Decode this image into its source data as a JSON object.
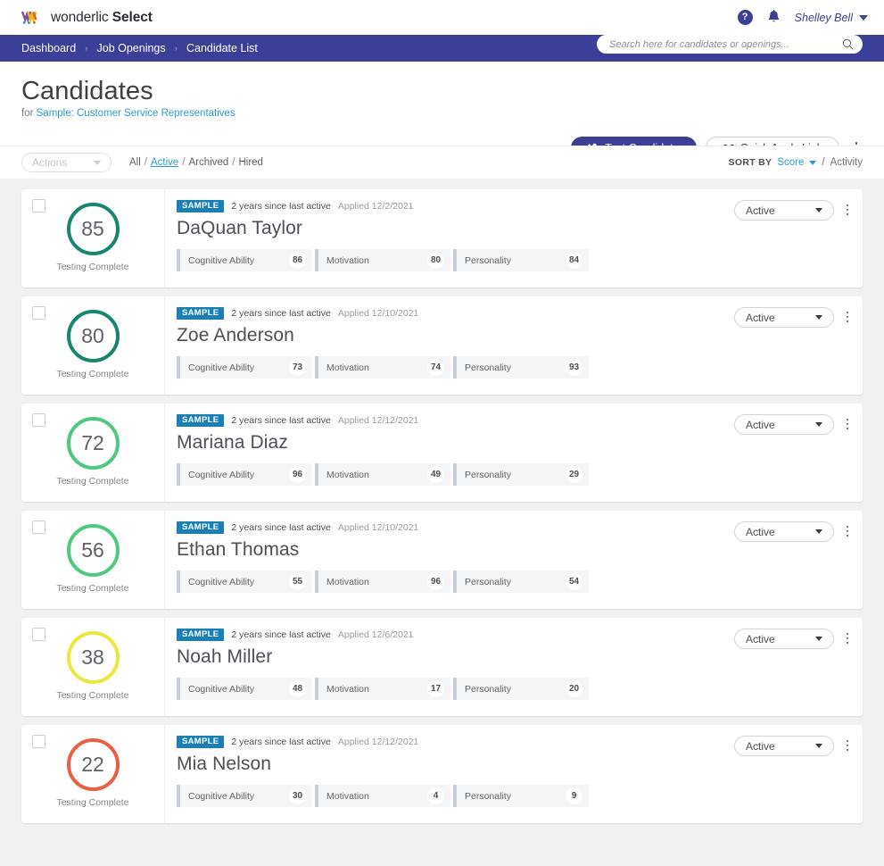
{
  "brand": {
    "name_light": "wonderlic",
    "name_bold": "Select",
    "primary_color": "#3b3f98",
    "link_color": "#2d9cd6"
  },
  "topbar": {
    "help_label": "?",
    "user_name": "Shelley Bell"
  },
  "breadcrumb": {
    "items": [
      "Dashboard",
      "Job Openings",
      "Candidate List"
    ],
    "separator": "›"
  },
  "search": {
    "placeholder": "Search here for candidates or openings...",
    "value": ""
  },
  "header": {
    "title": "Candidates",
    "for_label": "for",
    "job_link": "Sample: Customer Service Representatives",
    "test_candidate_label": "Test Candidate",
    "quick_apply_label": "Quick Apply Link"
  },
  "filters": {
    "actions_label": "Actions",
    "tabs": [
      {
        "label": "All",
        "active": false
      },
      {
        "label": "Active",
        "active": true
      },
      {
        "label": "Archived",
        "active": false
      },
      {
        "label": "Hired",
        "active": false
      }
    ],
    "tab_separator": "/",
    "sort_by_label": "SORT BY",
    "sort_selected": "Score",
    "sort_separator": "/",
    "sort_alternate": "Activity"
  },
  "metric_labels": [
    "Cognitive Ability",
    "Motivation",
    "Personality"
  ],
  "score_caption": "Testing Complete",
  "sample_badge": "SAMPLE",
  "status_label": "Active",
  "candidates": [
    {
      "score": "85",
      "score_color": "#17866f",
      "caption": "Testing Complete",
      "badge": "SAMPLE",
      "activity": "2 years since last active",
      "applied": "Applied 12/2/2021",
      "name": "DaQuan Taylor",
      "metrics": [
        {
          "label": "Cognitive Ability",
          "value": "86"
        },
        {
          "label": "Motivation",
          "value": "80"
        },
        {
          "label": "Personality",
          "value": "84"
        }
      ],
      "status": "Active"
    },
    {
      "score": "80",
      "score_color": "#17866f",
      "caption": "Testing Complete",
      "badge": "SAMPLE",
      "activity": "2 years since last active",
      "applied": "Applied 12/10/2021",
      "name": "Zoe Anderson",
      "metrics": [
        {
          "label": "Cognitive Ability",
          "value": "73"
        },
        {
          "label": "Motivation",
          "value": "74"
        },
        {
          "label": "Personality",
          "value": "93"
        }
      ],
      "status": "Active"
    },
    {
      "score": "72",
      "score_color": "#4ec97f",
      "caption": "Testing Complete",
      "badge": "SAMPLE",
      "activity": "2 years since last active",
      "applied": "Applied 12/12/2021",
      "name": "Mariana Diaz",
      "metrics": [
        {
          "label": "Cognitive Ability",
          "value": "96"
        },
        {
          "label": "Motivation",
          "value": "49"
        },
        {
          "label": "Personality",
          "value": "29"
        }
      ],
      "status": "Active"
    },
    {
      "score": "56",
      "score_color": "#4ec97f",
      "caption": "Testing Complete",
      "badge": "SAMPLE",
      "activity": "2 years since last active",
      "applied": "Applied 12/10/2021",
      "name": "Ethan Thomas",
      "metrics": [
        {
          "label": "Cognitive Ability",
          "value": "55"
        },
        {
          "label": "Motivation",
          "value": "96"
        },
        {
          "label": "Personality",
          "value": "54"
        }
      ],
      "status": "Active"
    },
    {
      "score": "38",
      "score_color": "#ece63e",
      "caption": "Testing Complete",
      "badge": "SAMPLE",
      "activity": "2 years since last active",
      "applied": "Applied 12/6/2021",
      "name": "Noah Miller",
      "metrics": [
        {
          "label": "Cognitive Ability",
          "value": "48"
        },
        {
          "label": "Motivation",
          "value": "17"
        },
        {
          "label": "Personality",
          "value": "20"
        }
      ],
      "status": "Active"
    },
    {
      "score": "22",
      "score_color": "#ec5f45",
      "caption": "Testing Complete",
      "badge": "SAMPLE",
      "activity": "2 years since last active",
      "applied": "Applied 12/12/2021",
      "name": "Mia Nelson",
      "metrics": [
        {
          "label": "Cognitive Ability",
          "value": "30"
        },
        {
          "label": "Motivation",
          "value": "4"
        },
        {
          "label": "Personality",
          "value": "9"
        }
      ],
      "status": "Active"
    }
  ]
}
